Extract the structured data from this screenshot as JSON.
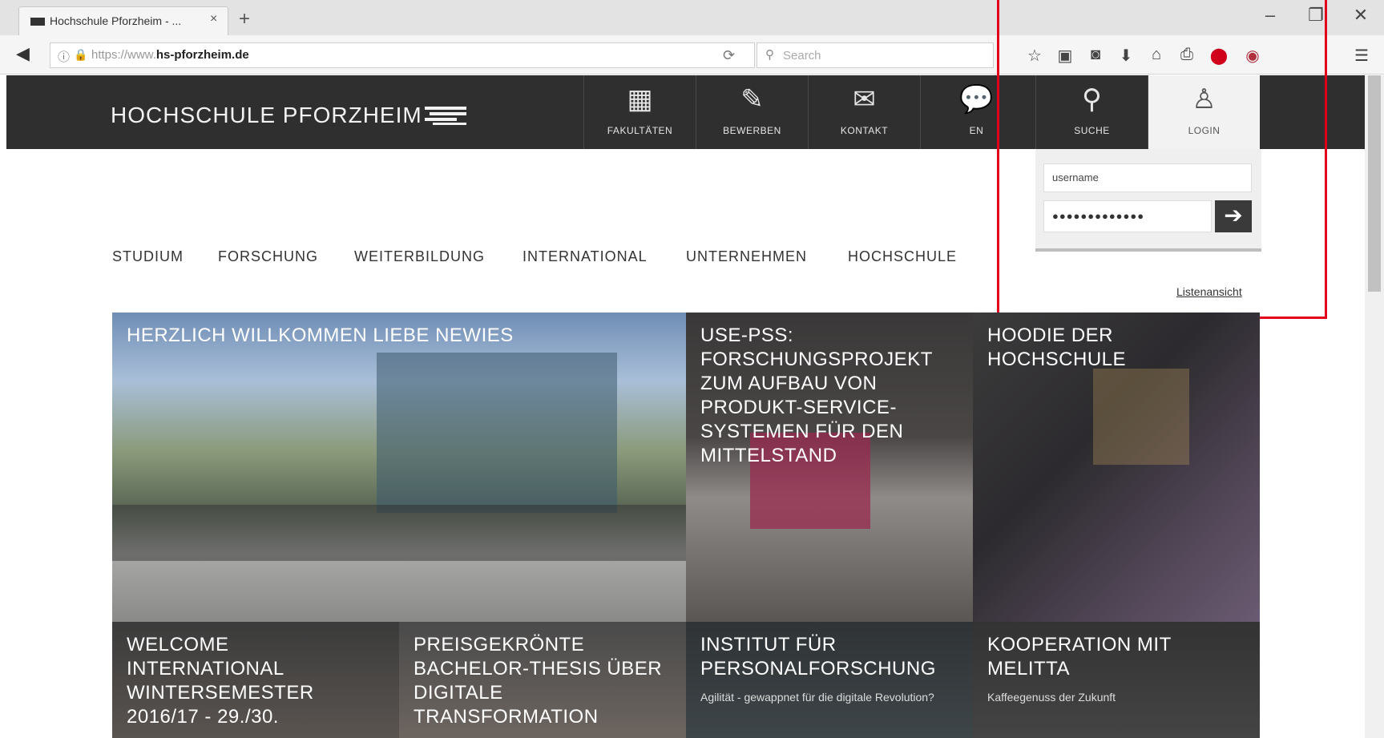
{
  "browser": {
    "tab_title": "Hochschule Pforzheim - ...",
    "tab_close": "×",
    "new_tab": "+",
    "url_prefix": "https://www.",
    "url_domain": "hs-pforzheim.de",
    "search_placeholder": "Search",
    "window_controls": [
      "–",
      "❐",
      "✕"
    ],
    "toolbar_icons": [
      "star-icon",
      "clipboard-icon",
      "pocket-icon",
      "download-icon",
      "home-icon",
      "print-icon",
      "adblock-icon",
      "extension-icon",
      "menu-icon"
    ]
  },
  "site": {
    "logo_text": "HOCHSCHULE PFORZHEIM",
    "header_nav": [
      {
        "label": "FAKULTÄTEN",
        "icon": "building-icon",
        "glyph": "▦"
      },
      {
        "label": "BEWERBEN",
        "icon": "edit-icon",
        "glyph": "✎"
      },
      {
        "label": "KONTAKT",
        "icon": "envelope-icon",
        "glyph": "✉"
      },
      {
        "label": "EN",
        "icon": "speech-bubble-icon",
        "glyph": "💬"
      },
      {
        "label": "SUCHE",
        "icon": "search-icon",
        "glyph": "⚲"
      },
      {
        "label": "LOGIN",
        "icon": "user-icon",
        "glyph": "♙"
      }
    ],
    "login": {
      "username_value": "username",
      "password_value": "●●●●●●●●●●●●●",
      "submit_glyph": "➔"
    },
    "main_nav": [
      "STUDIUM",
      "FORSCHUNG",
      "WEITERBILDUNG",
      "INTERNATIONAL",
      "UNTERNEHMEN",
      "HOCHSCHULE"
    ],
    "list_view_link": "Listenansicht",
    "tiles": [
      {
        "title": "HERZLICH WILLKOMMEN LIEBE NEWIES",
        "subtitle": ""
      },
      {
        "title": "USE-PSS: FORSCHUNGSPROJEKT ZUM AUFBAU VON PRODUKT-SERVICE-SYSTEMEN FÜR DEN MITTELSTAND",
        "subtitle": ""
      },
      {
        "title": "HOODIE DER HOCHSCHULE",
        "subtitle": ""
      },
      {
        "title": "WELCOME INTERNATIONAL WINTERSEMESTER 2016/17 - 29./30.",
        "subtitle": ""
      },
      {
        "title": "PREISGEKRÖNTE BACHELOR-THESIS ÜBER DIGITALE TRANSFORMATION",
        "subtitle": ""
      },
      {
        "title": "INSTITUT FÜR PERSONALFORSCHUNG",
        "subtitle": "Agilität - gewappnet für die digitale Revolution?"
      },
      {
        "title": "KOOPERATION MIT MELITTA",
        "subtitle": "Kaffeegenuss der Zukunft"
      }
    ]
  },
  "colors": {
    "header_bg": "#2f2f2f",
    "highlight_border": "#e3001b"
  }
}
